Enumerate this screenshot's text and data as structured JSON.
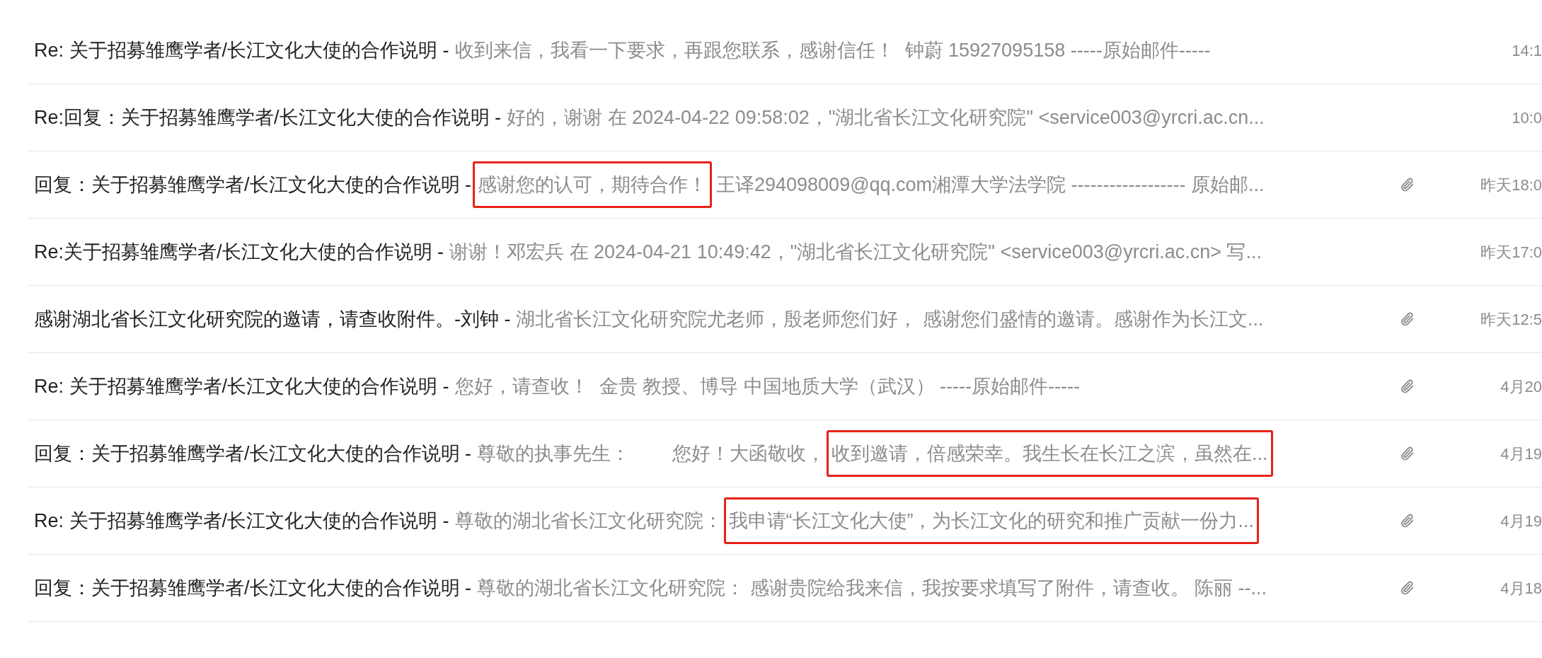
{
  "messages": [
    {
      "subject": "Re: 关于招募雏鹰学者/长江文化大使的合作说明 -",
      "preview": "收到来信，我看一下要求，再跟您联系，感谢信任！  钟蔚 15927095158 -----原始邮件-----",
      "attachment": false,
      "time": "14:1"
    },
    {
      "subject": "Re:回复：关于招募雏鹰学者/长江文化大使的合作说明 -",
      "preview": "好的，谢谢 在 2024-04-22 09:58:02，\"湖北省长江文化研究院\" <service003@yrcri.ac.cn...",
      "attachment": false,
      "time": "10:0"
    },
    {
      "subject": "回复：关于招募雏鹰学者/长江文化大使的合作说明 -",
      "highlight": "感谢您的认可，期待合作！",
      "preview_after": "王译294098009@qq.com湘潭大学法学院 ------------------ 原始邮...",
      "attachment": true,
      "time": "昨天18:0"
    },
    {
      "subject": "Re:关于招募雏鹰学者/长江文化大使的合作说明 -",
      "preview": "谢谢！邓宏兵 在 2024-04-21 10:49:42，\"湖北省长江文化研究院\" <service003@yrcri.ac.cn> 写...",
      "attachment": false,
      "time": "昨天17:0"
    },
    {
      "subject": "感谢湖北省长江文化研究院的邀请，请查收附件。-刘钟 -",
      "preview": "湖北省长江文化研究院尤老师，殷老师您们好， 感谢您们盛情的邀请。感谢作为长江文...",
      "attachment": true,
      "time": "昨天12:5"
    },
    {
      "subject": "Re: 关于招募雏鹰学者/长江文化大使的合作说明 -",
      "preview": "您好，请查收！  金贵 教授、博导 中国地质大学（武汉） -----原始邮件-----",
      "attachment": true,
      "time": "4月20"
    },
    {
      "subject": "回复：关于招募雏鹰学者/长江文化大使的合作说明 -",
      "preview": "尊敬的执事先生：        您好！大函敬收，",
      "highlight": "收到邀请，倍感荣幸。我生长在长江之滨，虽然在...",
      "attachment": true,
      "time": "4月19"
    },
    {
      "subject": "Re: 关于招募雏鹰学者/长江文化大使的合作说明 -",
      "preview": "尊敬的湖北省长江文化研究院：",
      "highlight": "我申请“长江文化大使”，为长江文化的研究和推广贡献一份力...",
      "attachment": true,
      "time": "4月19"
    },
    {
      "subject": "回复：关于招募雏鹰学者/长江文化大使的合作说明 -",
      "preview": "尊敬的湖北省长江文化研究院： 感谢贵院给我来信，我按要求填写了附件，请查收。 陈丽 --...",
      "attachment": true,
      "time": "4月18"
    }
  ]
}
